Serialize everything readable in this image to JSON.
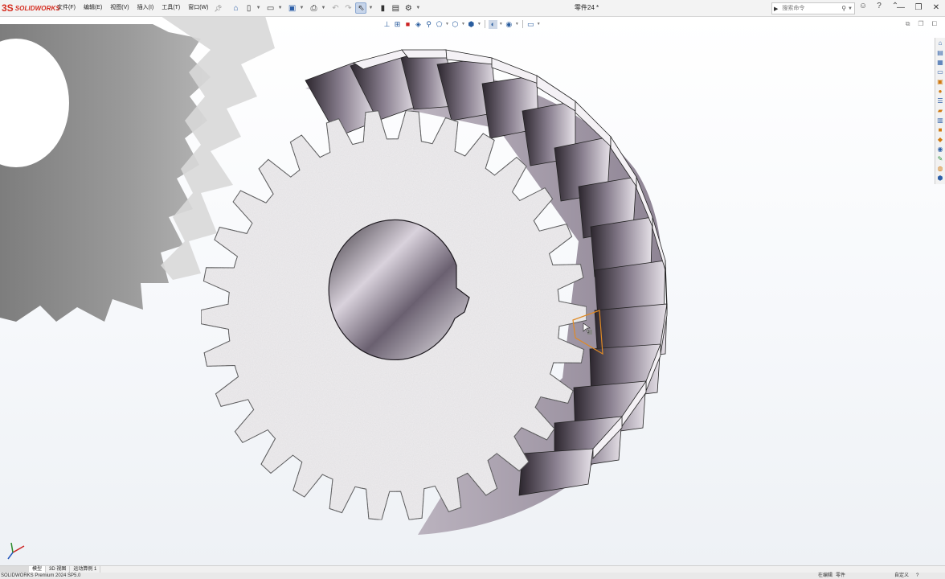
{
  "app": {
    "logo_mark": "3S",
    "logo_text": "SOLIDWORKS",
    "document_title": "零件24 *",
    "brand_color": "#d52b1e"
  },
  "menu": {
    "items": [
      "文件(F)",
      "编辑(E)",
      "视图(V)",
      "插入(I)",
      "工具(T)",
      "窗口(W)"
    ],
    "pin_icon": "pin-icon"
  },
  "quick_access": [
    {
      "name": "home-icon",
      "glyph": "⌂"
    },
    {
      "name": "new-document-icon",
      "glyph": "▯"
    },
    {
      "name": "open-icon",
      "glyph": "▭"
    },
    {
      "name": "save-icon",
      "glyph": "▣"
    },
    {
      "name": "print-icon",
      "glyph": "⎙"
    },
    {
      "name": "undo-icon",
      "glyph": "↶"
    },
    {
      "name": "redo-icon",
      "glyph": "↷"
    },
    {
      "name": "select-icon",
      "glyph": "⇖"
    },
    {
      "name": "rebuild-icon",
      "glyph": "▮"
    },
    {
      "name": "file-properties-icon",
      "glyph": "▤"
    },
    {
      "name": "options-icon",
      "glyph": "⚙"
    }
  ],
  "search": {
    "term_label": "▶",
    "placeholder": "搜索命令"
  },
  "title_icons": [
    "user-icon",
    "help-icon",
    "minimize-icon"
  ],
  "window_controls": {
    "minimize": "—",
    "restore": "❐",
    "close": "✕"
  },
  "heads_up_toolbar": [
    {
      "name": "zoom-to-fit-icon",
      "glyph": "⊥"
    },
    {
      "name": "zoom-to-area-icon",
      "glyph": "⊞"
    },
    {
      "name": "previous-view-icon",
      "glyph": "■"
    },
    {
      "name": "section-view-icon",
      "glyph": "◈"
    },
    {
      "name": "dynamic-annotation-icon",
      "glyph": "⚲"
    },
    {
      "name": "view-orientation-icon",
      "glyph": "⬠"
    },
    {
      "name": "display-style-icon",
      "glyph": "⬡"
    },
    {
      "name": "hide-show-items-icon",
      "glyph": "⬢"
    },
    {
      "name": "edit-appearance-icon",
      "glyph": "◐"
    },
    {
      "name": "apply-scene-icon",
      "glyph": "◉"
    },
    {
      "name": "view-settings-icon",
      "glyph": "▭"
    }
  ],
  "viewport_controls": [
    "tile-icon",
    "restore-pane-icon",
    "maximize-pane-icon"
  ],
  "task_pane": [
    "home-icon",
    "resources-icon",
    "design-library-icon",
    "file-explorer-icon",
    "view-palette-icon",
    "appearances-icon",
    "custom-properties-icon",
    "forum-icon",
    "toolbox-icon",
    "3d-content-icon",
    "mbd-icon",
    "solidworks-labs-icon",
    "markup-icon",
    "motion-icon",
    "simulation-icon"
  ],
  "bottom_tabs": {
    "items": [
      "模型",
      "3D 视图",
      "运动算例 1"
    ],
    "active": 0
  },
  "status_bar": {
    "product": "SOLIDWORKS Premium 2024 SP5.0",
    "editing": "在编辑",
    "editing_target": "零件",
    "units": "自定义",
    "help": "?"
  }
}
